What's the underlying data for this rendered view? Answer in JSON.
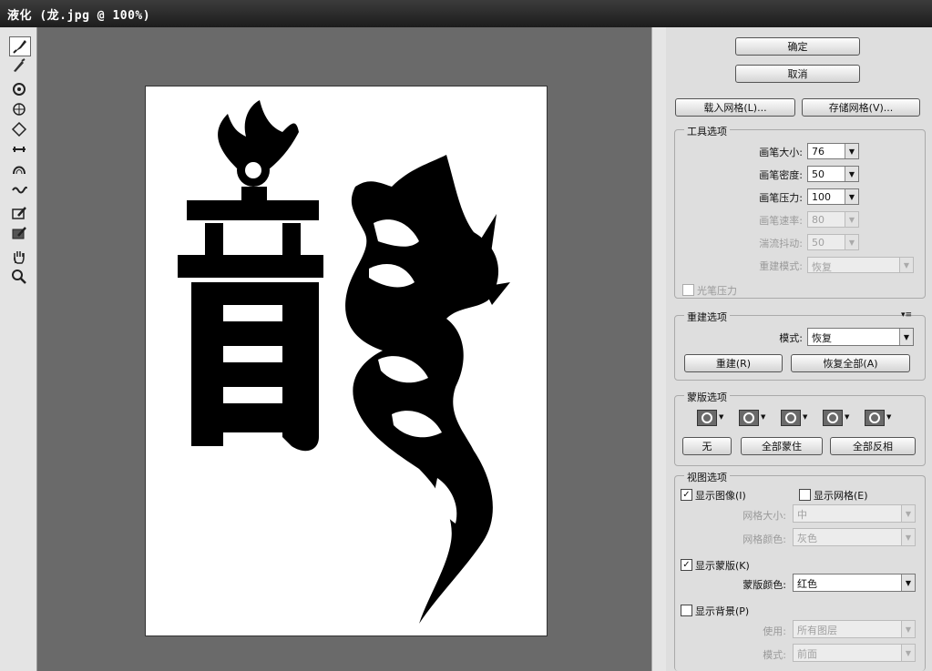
{
  "window": {
    "title": "液化 (龙.jpg @ 100%)"
  },
  "icons": [
    "forward-warp-icon",
    "reconstruct-icon",
    "twirl-icon",
    "pucker-icon",
    "bloat-icon",
    "push-left-icon",
    "mirror-icon",
    "turbulence-icon",
    "freeze-mask-icon",
    "thaw-mask-icon",
    "hand-icon",
    "zoom-icon"
  ],
  "buttons": {
    "ok": "确定",
    "cancel": "取消",
    "load_mesh": "载入网格(L)...",
    "save_mesh": "存储网格(V)..."
  },
  "tool_options": {
    "title": "工具选项",
    "brush_size_label": "画笔大小:",
    "brush_size": "76",
    "brush_density_label": "画笔密度:",
    "brush_density": "50",
    "brush_pressure_label": "画笔压力:",
    "brush_pressure": "100",
    "brush_rate_label": "画笔速率:",
    "brush_rate": "80",
    "turbulent_jitter_label": "湍流抖动:",
    "turbulent_jitter": "50",
    "reconstruct_mode_label": "重建模式:",
    "reconstruct_mode": "恢复",
    "stylus_pressure": "光笔压力"
  },
  "reconstruct_options": {
    "title": "重建选项",
    "mode_label": "模式:",
    "mode": "恢复",
    "reconstruct_btn": "重建(R)",
    "restore_all_btn": "恢复全部(A)"
  },
  "mask_options": {
    "title": "蒙版选项",
    "none_btn": "无",
    "mask_all_btn": "全部蒙住",
    "invert_all_btn": "全部反相"
  },
  "view_options": {
    "title": "视图选项",
    "show_image": "显示图像(I)",
    "show_mesh": "显示网格(E)",
    "mesh_size_label": "网格大小:",
    "mesh_size": "中",
    "mesh_color_label": "网格颜色:",
    "mesh_color": "灰色",
    "show_mask": "显示蒙版(K)",
    "mask_color_label": "蒙版颜色:",
    "mask_color": "红色",
    "show_backdrop": "显示背景(P)",
    "use_label": "使用:",
    "use_value": "所有图层",
    "mode_label": "模式:",
    "mode_value": "前面"
  },
  "colors": {
    "titlebar": "#2a2a2a",
    "canvas_bg": "#6a6a6a",
    "panel_bg": "#dedede"
  }
}
